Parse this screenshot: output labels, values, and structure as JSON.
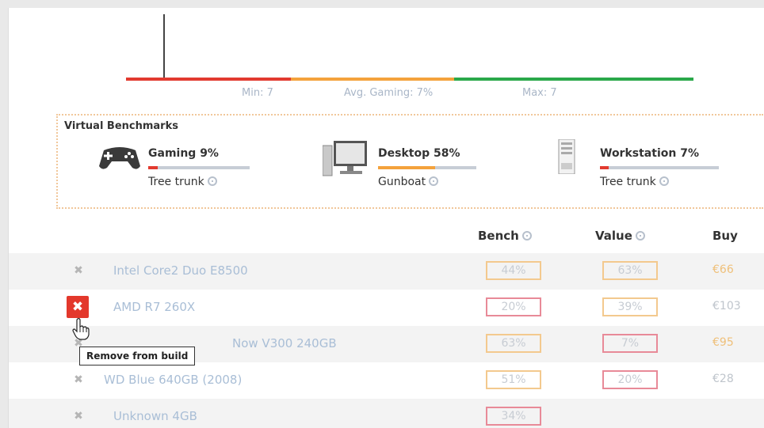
{
  "gauge": {
    "min_label": "Min: 7",
    "avg_label": "Avg. Gaming: 7%",
    "max_label": "Max: 7",
    "colors": {
      "red": "#e23a2f",
      "orange": "#f4a23c",
      "green": "#2aa84a"
    }
  },
  "benchmarks": {
    "title": "Virtual Benchmarks",
    "items": [
      {
        "name": "Gaming 9%",
        "sub": "Tree trunk",
        "level_percent": 9,
        "bar_color": "#e23a2f",
        "icon": "gamepad-icon"
      },
      {
        "name": "Desktop 58%",
        "sub": "Gunboat",
        "level_percent": 58,
        "bar_color": "#f4a23c",
        "icon": "desktop-computer-icon"
      },
      {
        "name": "Workstation 7%",
        "sub": "Tree trunk",
        "level_percent": 7,
        "bar_color": "#e23a2f",
        "icon": "server-tower-icon"
      }
    ]
  },
  "table": {
    "headers": {
      "bench": "Bench",
      "value": "Value",
      "buy": "Buy"
    },
    "rows": [
      {
        "remove": "✖",
        "name": "Intel Core2 Duo E8500",
        "bench": "44%",
        "value": "63%",
        "price": "€66",
        "bench_border": "orange",
        "value_border": "orange",
        "price_color": "orange"
      },
      {
        "remove": "✖",
        "name": "AMD R7 260X",
        "bench": "20%",
        "value": "39%",
        "price": "€103",
        "bench_border": "red",
        "value_border": "orange",
        "price_color": "gray"
      },
      {
        "remove": "✖",
        "name": "Now V300 240GB",
        "bench": "63%",
        "value": "7%",
        "price": "€95",
        "bench_border": "orange",
        "value_border": "red",
        "price_color": "orange"
      },
      {
        "remove": "✖",
        "name": "WD Blue 640GB (2008)",
        "bench": "51%",
        "value": "20%",
        "price": "€28",
        "bench_border": "orange",
        "value_border": "red",
        "price_color": "gray"
      },
      {
        "remove": "✖",
        "name": "Unknown 4GB",
        "bench": "34%",
        "value": "",
        "price": "",
        "bench_border": "red",
        "value_border": "orange",
        "price_color": "gray"
      }
    ]
  },
  "tooltip": "Remove from build"
}
